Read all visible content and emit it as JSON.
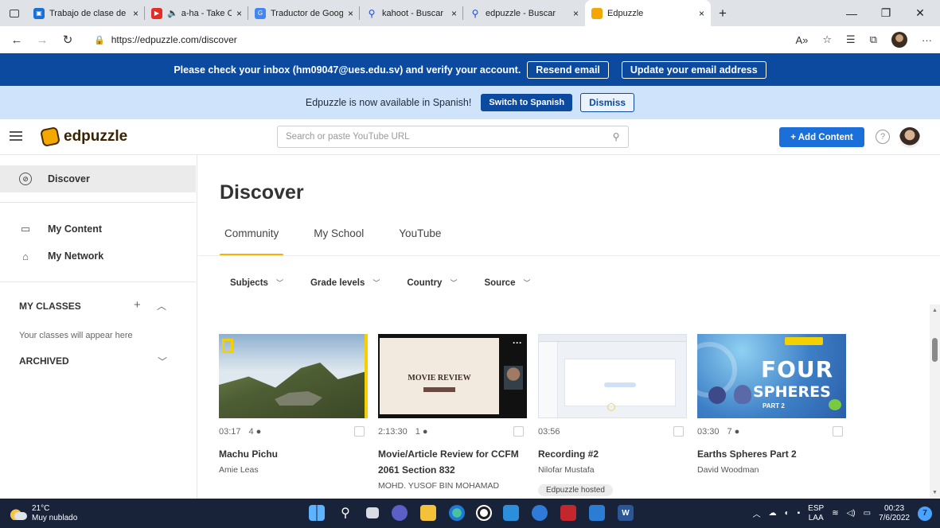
{
  "browser": {
    "tabs": [
      {
        "title": "Trabajo de clase de Pro",
        "close": "×",
        "color": "#1a6fd8"
      },
      {
        "title": "a-ha - Take On M",
        "close": "×",
        "color": "#e52d27"
      },
      {
        "title": "Traductor de Google",
        "close": "×",
        "color": "#4285f4"
      },
      {
        "title": "kahoot - Buscar",
        "close": "×",
        "color": "#174ae4"
      },
      {
        "title": "edpuzzle - Buscar",
        "close": "×",
        "color": "#174ae4"
      },
      {
        "title": "Edpuzzle",
        "close": "×",
        "color": "#f3a800"
      }
    ],
    "new_tab": "+",
    "url": "https://edpuzzle.com/discover"
  },
  "verify_banner": {
    "message": "Please check your inbox (hm09047@ues.edu.sv) and verify your account.",
    "resend": "Resend email",
    "update": "Update your email address",
    "bg": "#0c4aa0"
  },
  "spanish_banner": {
    "message": "Edpuzzle is now available in Spanish!",
    "switch": "Switch to Spanish",
    "dismiss": "Dismiss"
  },
  "header": {
    "logo": "edpuzzle",
    "search_placeholder": "Search or paste YouTube URL",
    "add_content": "+ Add Content",
    "help": "?"
  },
  "sidebar": {
    "discover": "Discover",
    "my_content": "My Content",
    "my_network": "My Network",
    "my_classes": "MY CLASSES",
    "classes_empty": "Your classes will appear here",
    "archived": "ARCHIVED"
  },
  "main": {
    "title": "Discover",
    "tabs": [
      "Community",
      "My School",
      "YouTube"
    ],
    "filters": [
      "Subjects",
      "Grade levels",
      "Country",
      "Source"
    ]
  },
  "cards": [
    {
      "duration": "03:17",
      "count": "4",
      "title": "Machu Pichu",
      "author": "Amie Leas"
    },
    {
      "duration": "2:13:30",
      "count": "1",
      "title": "Movie/Article Review for CCFM 2061 Section 832",
      "author": "MOHD. YUSOF BIN MOHAMAD",
      "thumb_text1": "MOVIE REVIEW"
    },
    {
      "duration": "03:56",
      "count": "",
      "title": "Recording #2",
      "author": "Nilofar Mustafa",
      "badge": "Edpuzzle hosted"
    },
    {
      "duration": "03:30",
      "count": "7",
      "title": "Earths Spheres Part 2",
      "author": "David Woodman",
      "thumb_text1": "FOUR",
      "thumb_text2": "SPHERES",
      "thumb_text3": "PART 2"
    }
  ],
  "taskbar": {
    "temp": "21°C",
    "weather": "Muy nublado",
    "lang1": "ESP",
    "lang2": "LAA",
    "time": "00:23",
    "date": "7/6/2022",
    "notifications": "7"
  }
}
